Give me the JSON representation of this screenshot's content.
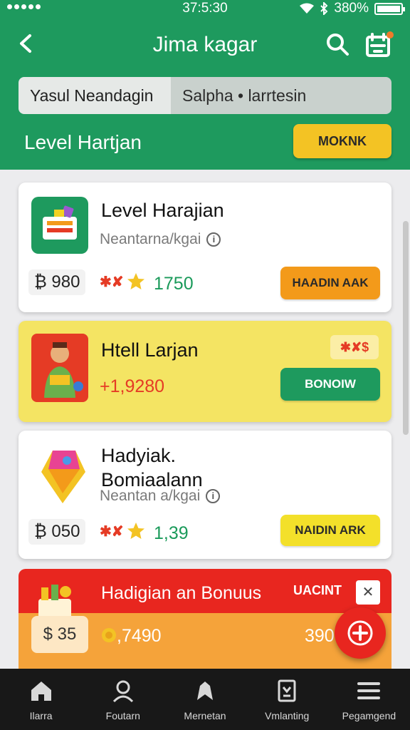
{
  "status_bar": {
    "time": "37:5:30",
    "battery": "380%"
  },
  "header": {
    "title": "Jima kagar",
    "tabs": [
      "Yasul Neandagin",
      "Salpha • larrtesin"
    ],
    "level_label": "Level Hartjan",
    "action_button": "MOKNK"
  },
  "cards": [
    {
      "title": "Level Harajian",
      "subtitle": "Neantarna/kgai",
      "price": "₿ 980",
      "badge": "✱✘",
      "score": "1750",
      "button": "HAADIN AAK",
      "button_color": "#f39a1a"
    },
    {
      "title": "Htell Larjan",
      "amount": "+1,9280",
      "badge": "✱✘$",
      "button": "BONOIW",
      "button_color": "#1e9a5e"
    },
    {
      "title_line1": "Hadyiak.",
      "title_line2": "Bomiaalann",
      "subtitle": "Neantan a/kgai",
      "price": "₿ 050",
      "badge": "✱✘",
      "score": "1,39",
      "button": "NAIDIN ARK",
      "button_color": "#f3e02a"
    },
    {
      "title": "Hadigian an Bonuus",
      "tag": "UACINT",
      "close": "✕",
      "price": "$ 35",
      "amount": ",7490",
      "amount_right": "390"
    }
  ],
  "nav": [
    {
      "label": "Ilarra",
      "icon": "home-icon"
    },
    {
      "label": "Foutarn",
      "icon": "user-search-icon"
    },
    {
      "label": "Mernetan",
      "icon": "location-icon"
    },
    {
      "label": "Vmlanting",
      "icon": "document-icon"
    },
    {
      "label": "Pegamgend",
      "icon": "menu-icon"
    }
  ]
}
